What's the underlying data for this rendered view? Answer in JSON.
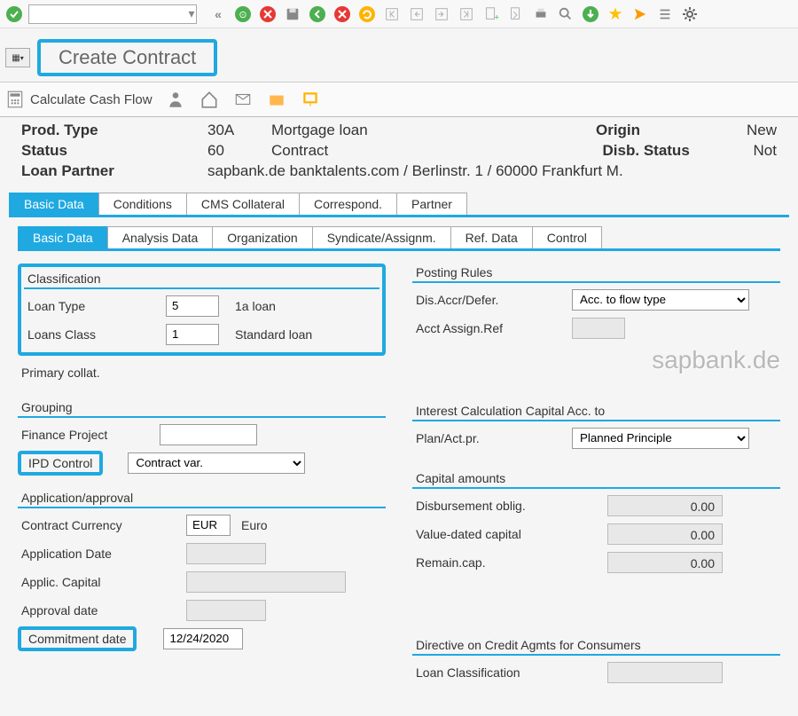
{
  "toolbar": {
    "combo_value": "",
    "icons": {
      "back": "back-icon",
      "double_back": "double-back-icon",
      "globe": "globe-icon",
      "cancel": "cancel-icon",
      "save": "save-icon",
      "refresh": "refresh-icon",
      "first": "first-icon",
      "prev": "prev-icon",
      "next": "next-icon",
      "last": "last-icon",
      "new": "new-icon",
      "copy": "copy-icon",
      "print": "print-icon",
      "find": "find-icon",
      "export": "export-icon",
      "star": "star-icon",
      "send": "send-icon",
      "list": "list-icon",
      "settings": "settings-icon"
    }
  },
  "page_title": "Create Contract",
  "action_bar": {
    "calc_label": "Calculate Cash Flow"
  },
  "info": {
    "prod_type_label": "Prod. Type",
    "prod_type_code": "30A",
    "prod_type_desc": "Mortgage loan",
    "origin_label": "Origin",
    "origin_val": "New",
    "status_label": "Status",
    "status_code": "60",
    "status_desc": "Contract",
    "disb_label": "Disb. Status",
    "disb_val": "Not",
    "partner_label": "Loan Partner",
    "partner_val": "sapbank.de banktalents.com / Berlinstr. 1 / 60000 Frankfurt M."
  },
  "main_tabs": [
    "Basic Data",
    "Conditions",
    "CMS Collateral",
    "Correspond.",
    "Partner"
  ],
  "sub_tabs": [
    "Basic Data",
    "Analysis Data",
    "Organization",
    "Syndicate/Assignm.",
    "Ref. Data",
    "Control"
  ],
  "classification": {
    "title": "Classification",
    "loan_type_label": "Loan Type",
    "loan_type_val": "5",
    "loan_type_desc": "1a loan",
    "loans_class_label": "Loans Class",
    "loans_class_val": "1",
    "loans_class_desc": "Standard loan",
    "primary_collat_label": "Primary collat."
  },
  "posting_rules": {
    "title": "Posting Rules",
    "disaccr_label": "Dis.Accr/Defer.",
    "disaccr_val": "Acc. to flow type",
    "acct_assign_label": "Acct Assign.Ref"
  },
  "grouping": {
    "title": "Grouping",
    "finance_project_label": "Finance Project",
    "ipd_control_label": "IPD Control",
    "ipd_control_val": "Contract var."
  },
  "interest_calc": {
    "title": "Interest Calculation Capital Acc. to",
    "plan_label": "Plan/Act.pr.",
    "plan_val": "Planned Principle"
  },
  "application": {
    "title": "Application/approval",
    "currency_label": "Contract Currency",
    "currency_val": "EUR",
    "currency_desc": "Euro",
    "app_date_label": "Application Date",
    "app_capital_label": "Applic. Capital",
    "approval_date_label": "Approval date",
    "commitment_date_label": "Commitment date",
    "commitment_date_val": "12/24/2020"
  },
  "capital": {
    "title": "Capital amounts",
    "disb_oblig_label": "Disbursement oblig.",
    "disb_oblig_val": "0.00",
    "value_dated_label": "Value-dated capital",
    "value_dated_val": "0.00",
    "remain_label": "Remain.cap.",
    "remain_val": "0.00"
  },
  "directive": {
    "title": "Directive on Credit Agmts for Consumers",
    "loan_class_label": "Loan Classification"
  },
  "watermark": "sapbank.de"
}
